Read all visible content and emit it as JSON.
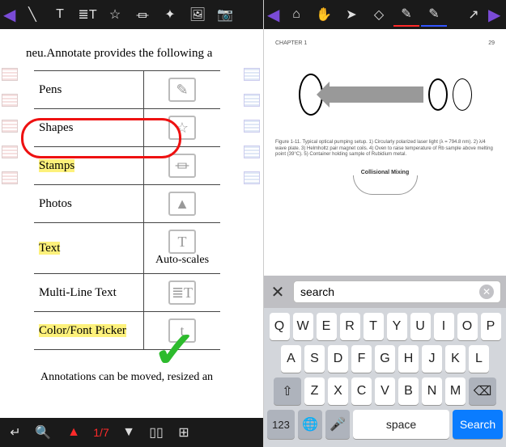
{
  "left": {
    "toolbar": {
      "back": "◀",
      "pen": "╲",
      "text": "T",
      "multiline": "≣T",
      "shapes": "☆",
      "stamp": "⏛",
      "compass": "✦",
      "photo": "🖼",
      "camera": "📷"
    },
    "doc": {
      "intro": "neu.Annotate provides the following a",
      "rows": [
        {
          "label": "Pens",
          "icon": "✎",
          "hl": false
        },
        {
          "label": "Shapes",
          "icon": "☆",
          "hl": false
        },
        {
          "label": "Stamps",
          "icon": "⏛",
          "hl": true
        },
        {
          "label": "Photos",
          "icon": "▲",
          "hl": false
        },
        {
          "label": "Text",
          "icon": "T",
          "hl": true
        },
        {
          "label": "Multi-Line Text",
          "icon": "≣T",
          "hl": false
        },
        {
          "label": "Color/Font Picker",
          "icon": "t",
          "hl": true
        }
      ],
      "auto_scales": "Auto-scales",
      "footer_line": "Annotations can be moved, resized an"
    },
    "bottom": {
      "back": "↵",
      "search": "🔍",
      "prev": "▲",
      "page": "1/7",
      "next": "▼",
      "bookmarks": "▯▯",
      "thumbnails": "⊞"
    }
  },
  "right": {
    "toolbar": {
      "back": "◀",
      "home": "⌂",
      "hand": "✋",
      "cursor": "➤",
      "eraser": "◇",
      "pencil": "✎",
      "pen2": "✎",
      "share": "↗",
      "fwd": "▶"
    },
    "doc": {
      "chapter": "CHAPTER 1",
      "page": "29",
      "caption": "Figure 1-11. Typical optical pumping setup. 1) Circularly polarized laser light (λ = 794.8 nm). 2) λ/4 wave plate. 3) Helmholtz pair magnet coils. 4) Oven to raise temperature of Rb sample above melting point (39°C). 5) Container holding sample of Rubidium metal.",
      "collisional": "Collisional Mixing"
    },
    "search": {
      "close": "✕",
      "placeholder": "search",
      "value": "search",
      "clear": "✕"
    },
    "keyboard": {
      "row1": [
        "Q",
        "W",
        "E",
        "R",
        "T",
        "Y",
        "U",
        "I",
        "O",
        "P"
      ],
      "row2": [
        "A",
        "S",
        "D",
        "F",
        "G",
        "H",
        "J",
        "K",
        "L"
      ],
      "row3": [
        "Z",
        "X",
        "C",
        "V",
        "B",
        "N",
        "M"
      ],
      "shift": "⇧",
      "backspace": "⌫",
      "numbers": "123",
      "globe": "🌐",
      "mic": "🎤",
      "space": "space",
      "search": "Search"
    }
  }
}
